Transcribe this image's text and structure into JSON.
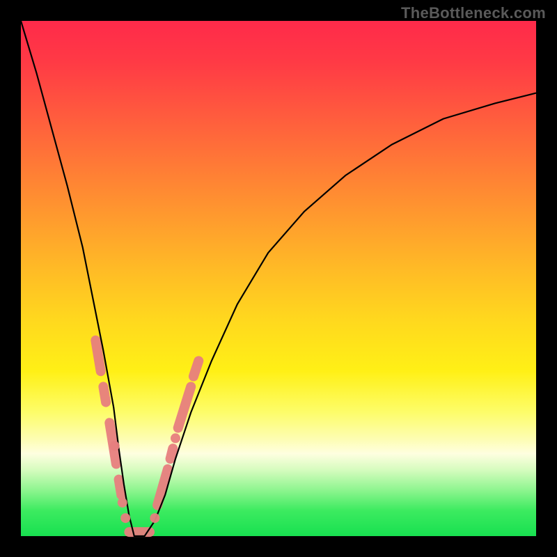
{
  "watermark": "TheBottleneck.com",
  "colors": {
    "background": "#000000",
    "curve": "#000000",
    "marker": "#e77e7e",
    "gradient_top": "#ff2a4a",
    "gradient_bottom": "#18e050"
  },
  "chart_data": {
    "type": "line",
    "title": "",
    "xlabel": "",
    "ylabel": "",
    "xlim": [
      0,
      100
    ],
    "ylim": [
      0,
      100
    ],
    "grid": false,
    "legend": null,
    "annotations": [
      {
        "text": "TheBottleneck.com",
        "position": "top-right"
      }
    ],
    "series": [
      {
        "name": "bottleneck-curve",
        "x": [
          0,
          3,
          6,
          9,
          12,
          14,
          16,
          18,
          19,
          20,
          21,
          22,
          24,
          26,
          28,
          30,
          33,
          37,
          42,
          48,
          55,
          63,
          72,
          82,
          92,
          100
        ],
        "y": [
          100,
          90,
          79,
          68,
          56,
          46,
          36,
          25,
          17,
          10,
          4,
          0,
          0,
          3,
          8,
          15,
          24,
          34,
          45,
          55,
          63,
          70,
          76,
          81,
          84,
          86
        ]
      }
    ],
    "markers": {
      "left_branch_segments": [
        {
          "x0": 14.5,
          "y0": 38,
          "x1": 15.5,
          "y1": 32
        },
        {
          "x0": 16.0,
          "y0": 29,
          "x1": 16.5,
          "y1": 26
        },
        {
          "x0": 17.2,
          "y0": 22,
          "x1": 18.5,
          "y1": 14
        },
        {
          "x0": 19.0,
          "y0": 11,
          "x1": 19.5,
          "y1": 8
        }
      ],
      "right_branch_segments": [
        {
          "x0": 26.5,
          "y0": 6,
          "x1": 28.5,
          "y1": 13
        },
        {
          "x0": 29.0,
          "y0": 15,
          "x1": 29.5,
          "y1": 17
        },
        {
          "x0": 30.5,
          "y0": 21,
          "x1": 33.0,
          "y1": 29
        },
        {
          "x0": 33.5,
          "y0": 31,
          "x1": 34.5,
          "y1": 34
        }
      ],
      "bottom_segment": {
        "x0": 21.0,
        "y0": 0.8,
        "x1": 25.0,
        "y1": 0.8
      },
      "dots": [
        {
          "x": 18.2,
          "y": 17.5
        },
        {
          "x": 19.7,
          "y": 6.5
        },
        {
          "x": 20.3,
          "y": 3.5
        },
        {
          "x": 26.0,
          "y": 3.5
        },
        {
          "x": 30.0,
          "y": 19.0
        }
      ]
    }
  }
}
